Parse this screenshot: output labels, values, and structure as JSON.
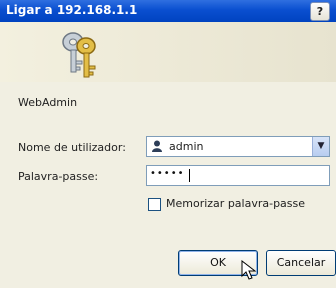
{
  "window": {
    "title": "Ligar a 192.168.1.1",
    "help_label": "?"
  },
  "banner": {
    "icon": "keys-icon"
  },
  "form": {
    "realm": "WebAdmin",
    "username_label": "Nome de utilizador:",
    "username_value": "admin",
    "password_label": "Palavra-passe:",
    "password_value": "•••••",
    "remember_label": "Memorizar palavra-passe",
    "remember_checked": false
  },
  "buttons": {
    "ok": "OK",
    "cancel": "Cancelar"
  }
}
